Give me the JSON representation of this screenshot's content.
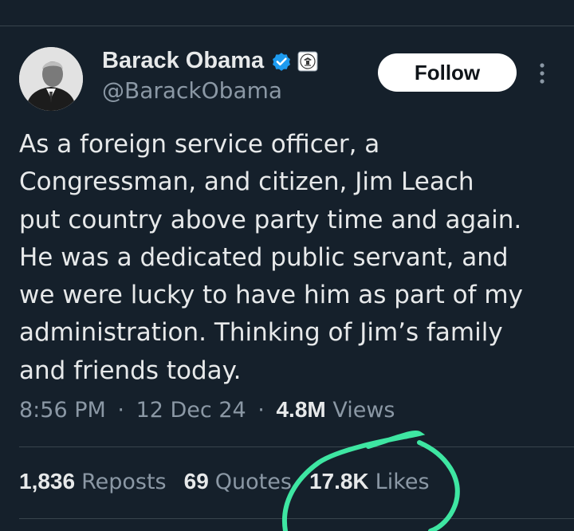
{
  "author": {
    "display_name": "Barack Obama",
    "handle": "@BarackObama",
    "verified_icon": "verified-badge-icon",
    "affiliation_icon": "government-seal-icon"
  },
  "follow_button": {
    "label": "Follow"
  },
  "more_icon": "more-options-icon",
  "tweet": {
    "lines": [
      "As a foreign service officer, a",
      "Congressman, and citizen, Jim Leach",
      "put country above party time and again.",
      "He was a dedicated public servant, and",
      "we were lucky to have him as part of my",
      "administration. Thinking of Jim’s family",
      "and friends today."
    ]
  },
  "meta": {
    "time": "8:56 PM",
    "separator": "·",
    "date": "12 Dec 24",
    "views_count": "4.8M",
    "views_label": "Views"
  },
  "stats": [
    {
      "count": "1,836",
      "label": "Reposts"
    },
    {
      "count": "69",
      "label": "Quotes"
    },
    {
      "count": "17.8K",
      "label": "Likes"
    }
  ],
  "colors": {
    "background": "#15202b",
    "text_primary": "#e7e9ea",
    "text_secondary": "#8b98a5",
    "verified_blue": "#1d9bf0",
    "highlight_stroke": "#3ee6a2"
  }
}
